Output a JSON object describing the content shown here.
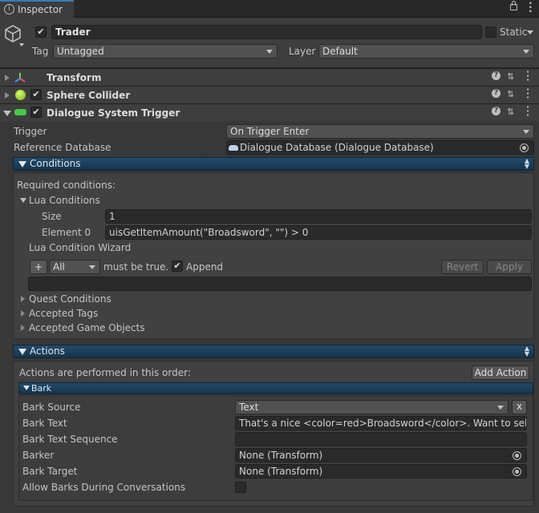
{
  "tab": {
    "label": "Inspector"
  },
  "gameobject": {
    "name": "Trader",
    "active_checked": true,
    "static_label": "Static",
    "tag_label": "Tag",
    "tag_value": "Untagged",
    "layer_label": "Layer",
    "layer_value": "Default"
  },
  "components": [
    {
      "name": "Transform",
      "icon": "transform-axes-icon"
    },
    {
      "name": "Sphere Collider",
      "icon": "sphere-collider-icon",
      "enabled": true
    },
    {
      "name": "Dialogue System Trigger",
      "icon": "dialogue-trigger-icon",
      "enabled": true
    }
  ],
  "trigger": {
    "trigger_label": "Trigger",
    "trigger_value": "On Trigger Enter",
    "refdb_label": "Reference Database",
    "refdb_value": "Dialogue Database (Dialogue Database)"
  },
  "conditions": {
    "section_label": "Conditions",
    "required_label": "Required conditions:",
    "lua_label": "Lua Conditions",
    "size_label": "Size",
    "size_value": "1",
    "element_label": "Element 0",
    "element_value": "uisGetItemAmount(\"Broadsword\", \"\") > 0",
    "wizard_label": "Lua Condition Wizard",
    "plus_label": "+",
    "all_value": "All",
    "must_be_true": "must be true.",
    "append_label": "Append",
    "revert_label": "Revert",
    "apply_label": "Apply",
    "quest_label": "Quest Conditions",
    "tags_label": "Accepted Tags",
    "gameobjects_label": "Accepted Game Objects"
  },
  "actions": {
    "section_label": "Actions",
    "order_label": "Actions are performed in this order:",
    "add_action_label": "Add Action",
    "bark": {
      "header": "Bark",
      "source_label": "Bark Source",
      "source_value": "Text",
      "remove_label": "x",
      "text_label": "Bark Text",
      "text_value": "That's a nice <color=red>Broadsword</color>. Want to sell it?",
      "sequence_label": "Bark Text Sequence",
      "sequence_value": "",
      "barker_label": "Barker",
      "barker_value": "None (Transform)",
      "target_label": "Bark Target",
      "target_value": "None (Transform)",
      "allow_label": "Allow Barks During Conversations"
    }
  },
  "colors": {
    "section_blue": "#1e4564",
    "background": "#383838",
    "field": "#2a2a2a"
  }
}
